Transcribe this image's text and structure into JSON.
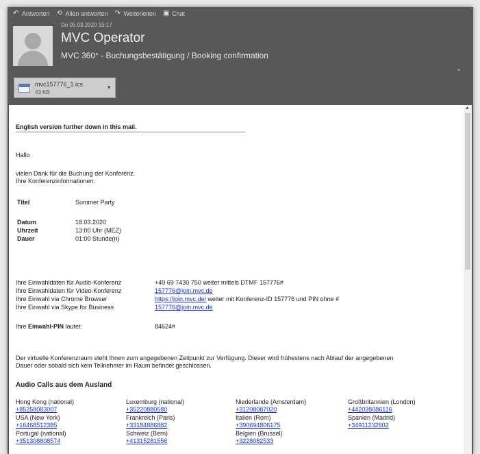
{
  "toolbar": {
    "items": [
      {
        "label": "Antworten",
        "icon": "reply-icon"
      },
      {
        "label": "Allen antworten",
        "icon": "reply-all-icon"
      },
      {
        "label": "Weiterleiten",
        "icon": "forward-icon"
      },
      {
        "label": "Chat",
        "icon": "chat-icon"
      }
    ]
  },
  "message": {
    "date": "Do 05.03.2020 15:17",
    "sender": "MVC Operator",
    "subject": "MVC 360° - Buchungsbestätigung / Booking confirmation"
  },
  "attachment": {
    "name": "mvc157776_1.ics",
    "size": "43 KB"
  },
  "body": {
    "notice": "English version further down in this mail.",
    "greeting": "Hallo",
    "intro_line1": "vielen Dank für die Buchung der Konferenz.",
    "intro_line2": "Ihre Konferenzinformationen:",
    "details": [
      {
        "label": "Titel",
        "value": "Summer Party"
      },
      {
        "label": "Datum",
        "value": "18.03.2020"
      },
      {
        "label": "Uhrzeit",
        "value": "13:00 Uhr (MEZ)"
      },
      {
        "label": "Dauer",
        "value": "01:00 Stunde(n)"
      }
    ],
    "dialin": [
      {
        "label": "Ihre Einwahldaten für Audio-Konferenz",
        "value": "+49 69 7430 750 weiter mittels DTMF 157776#",
        "link": "",
        "suffix": ""
      },
      {
        "label": "Ihre Einwahldaten für Video-Konferenz",
        "value": "",
        "link": "157776@join.mvc.de",
        "suffix": ""
      },
      {
        "label": "Ihre Einwahl via Chrome Browser",
        "value": "",
        "link": "https://join.mvc.de/",
        "suffix": " weiter mit Konferenz-ID 157776 und PIN ohne #"
      },
      {
        "label": "Ihre Einwahl via Skype for Business",
        "value": "",
        "link": "157776@join.mvc.de",
        "suffix": ""
      }
    ],
    "pin_label_prefix": "Ihre ",
    "pin_label_bold": "Einwahl-PIN",
    "pin_label_suffix": " lautet:",
    "pin_value": "84624#",
    "room_line1": "Der virtuelle Konferenzraum steht Ihnen zum angegebenen Zeitpunkt zur Verfügung. Dieser wird frühestens nach Ablauf der angegebenen",
    "room_line2": "Dauer oder sobald sich kein Teilnehmer im Raum befindet geschlossen.",
    "audio_heading": "Audio Calls aus dem Ausland",
    "calls": [
      [
        {
          "country": "Hong Kong (national)",
          "number": "+85258083007"
        },
        {
          "country": "Luxemburg (national)",
          "number": "+35220880580"
        },
        {
          "country": "Niederlande (Amsterdam)",
          "number": "+31208087020"
        },
        {
          "country": "Großbritannien (London)",
          "number": "+442038086116"
        }
      ],
      [
        {
          "country": "USA (New York)",
          "number": "+16468512385"
        },
        {
          "country": "Frankreich (Paris)",
          "number": "+33184886882"
        },
        {
          "country": "Italien (Rom)",
          "number": "+390694806175"
        },
        {
          "country": "Spanien (Madrid)",
          "number": "+34911232602"
        }
      ],
      [
        {
          "country": "Portugal (national)",
          "number": "+351308808574"
        },
        {
          "country": "Schweiz (Bern)",
          "number": "+41315281556"
        },
        {
          "country": "Belgien (Brussel)",
          "number": "+3228082533"
        },
        {
          "country": "",
          "number": ""
        }
      ]
    ]
  }
}
